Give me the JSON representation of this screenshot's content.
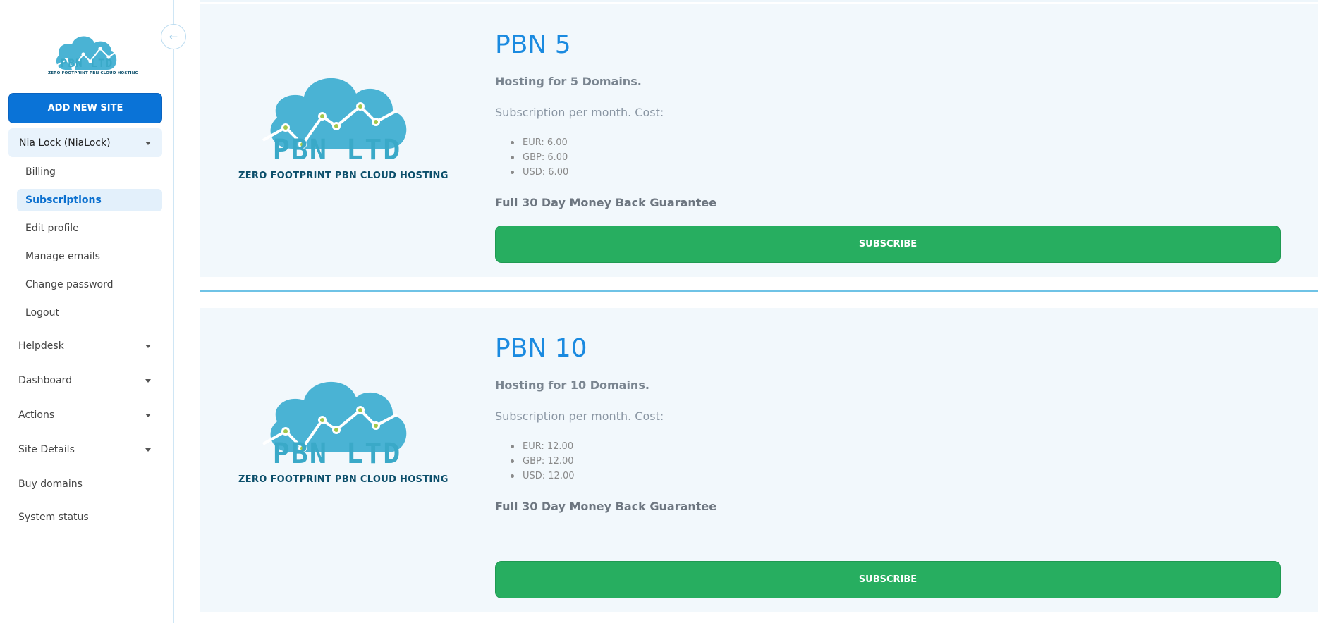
{
  "sidebar": {
    "logo": {
      "name": "PBN LTD",
      "tagline": "ZERO FOOTPRINT PBN CLOUD HOSTING"
    },
    "collapse_icon": "←",
    "add_site_label": "ADD NEW SITE",
    "user_label": "Nia Lock (NiaLock)",
    "sub_items": [
      "Billing",
      "Subscriptions",
      "Edit profile",
      "Manage emails",
      "Change password",
      "Logout"
    ],
    "active_sub_item": "Subscriptions",
    "nav_items": [
      "Helpdesk",
      "Dashboard",
      "Actions",
      "Site Details",
      "Buy domains",
      "System status"
    ]
  },
  "plans": [
    {
      "title": "PBN 5",
      "hosting": "Hosting for 5 Domains.",
      "subscription_text": "Subscription per month. Cost:",
      "prices": [
        "EUR: 6.00",
        "GBP: 6.00",
        "USD: 6.00"
      ],
      "guarantee": "Full 30 Day Money Back Guarantee",
      "subscribe_label": "SUBSCRIBE",
      "logo_name": "PBN LTD",
      "logo_tagline": "ZERO FOOTPRINT PBN CLOUD HOSTING"
    },
    {
      "title": "PBN 10",
      "hosting": "Hosting for 10 Domains.",
      "subscription_text": "Subscription per month. Cost:",
      "prices": [
        "EUR: 12.00",
        "GBP: 12.00",
        "USD: 12.00"
      ],
      "guarantee": "Full 30 Day Money Back Guarantee",
      "subscribe_label": "SUBSCRIBE",
      "logo_name": "PBN LTD",
      "logo_tagline": "ZERO FOOTPRINT PBN CLOUD HOSTING"
    }
  ],
  "colors": {
    "primary": "#0a73d7",
    "success": "#27ae60",
    "title": "#1a8ae0",
    "logo": "#4ab3d4"
  }
}
